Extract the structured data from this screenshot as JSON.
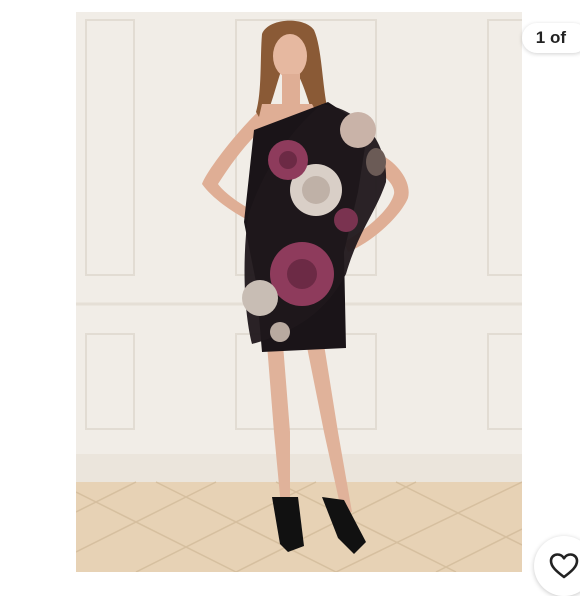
{
  "viewer": {
    "image_counter": "1 of",
    "heart_icon": "heart-outline-icon"
  },
  "colors": {
    "wall": "#f1ede7",
    "floor": "#e7d2b5",
    "dress_base": "#1a1418",
    "rose_pink": "#8e3b5c",
    "rose_light": "#d9cfc7"
  }
}
